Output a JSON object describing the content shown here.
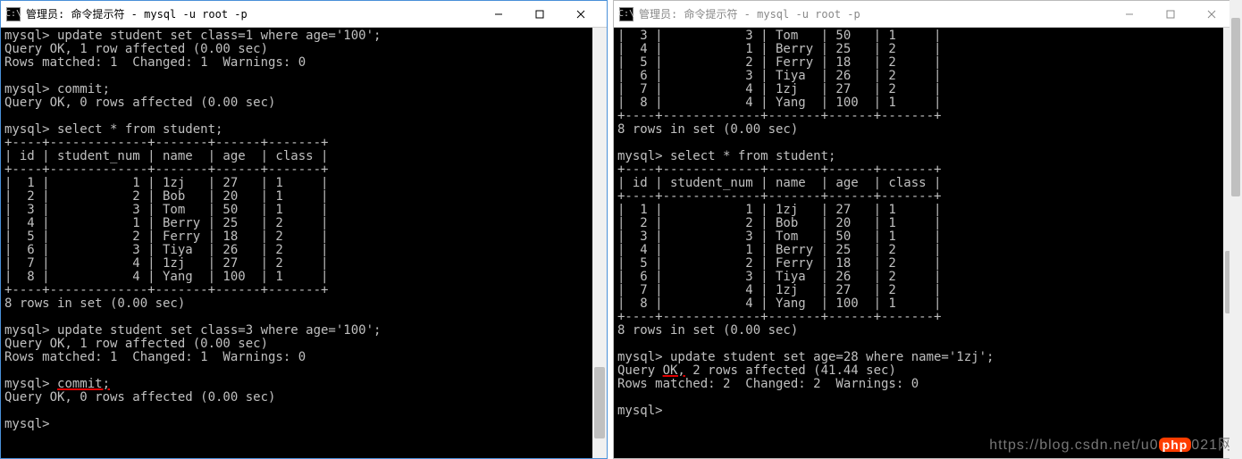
{
  "left": {
    "title": "管理员: 命令提示符 - mysql  -u root -p",
    "lines": [
      {
        "t": "mysql> update student set class=1 where age='100';"
      },
      {
        "t": "Query OK, 1 row affected (0.00 sec)"
      },
      {
        "t": "Rows matched: 1  Changed: 1  Warnings: 0"
      },
      {
        "t": ""
      },
      {
        "t": "mysql> commit;"
      },
      {
        "t": "Query OK, 0 rows affected (0.00 sec)"
      },
      {
        "t": ""
      },
      {
        "t": "mysql> select * from student;"
      },
      {
        "t": "+----+-------------+-------+------+-------+"
      },
      {
        "t": "| id | student_num | name  | age  | class |"
      },
      {
        "t": "+----+-------------+-------+------+-------+"
      },
      {
        "t": "|  1 |           1 | 1zj   | 27   | 1     |"
      },
      {
        "t": "|  2 |           2 | Bob   | 20   | 1     |"
      },
      {
        "t": "|  3 |           3 | Tom   | 50   | 1     |"
      },
      {
        "t": "|  4 |           1 | Berry | 25   | 2     |"
      },
      {
        "t": "|  5 |           2 | Ferry | 18   | 2     |"
      },
      {
        "t": "|  6 |           3 | Tiya  | 26   | 2     |"
      },
      {
        "t": "|  7 |           4 | 1zj   | 27   | 2     |"
      },
      {
        "t": "|  8 |           4 | Yang  | 100  | 1     |"
      },
      {
        "t": "+----+-------------+-------+------+-------+"
      },
      {
        "t": "8 rows in set (0.00 sec)"
      },
      {
        "t": ""
      },
      {
        "t": "mysql> update student set class=3 where age='100';"
      },
      {
        "t": "Query OK, 1 row affected (0.00 sec)"
      },
      {
        "t": "Rows matched: 1  Changed: 1  Warnings: 0"
      },
      {
        "t": ""
      },
      {
        "pre": "mysql> ",
        "u": "commit;",
        "post": ""
      },
      {
        "t": "Query OK, 0 rows affected (0.00 sec)"
      },
      {
        "t": ""
      },
      {
        "t": "mysql>"
      }
    ]
  },
  "right": {
    "title": "管理员: 命令提示符 - mysql  -u root -p",
    "lines": [
      {
        "t": "|  3 |           3 | Tom   | 50   | 1     |"
      },
      {
        "t": "|  4 |           1 | Berry | 25   | 2     |"
      },
      {
        "t": "|  5 |           2 | Ferry | 18   | 2     |"
      },
      {
        "t": "|  6 |           3 | Tiya  | 26   | 2     |"
      },
      {
        "t": "|  7 |           4 | 1zj   | 27   | 2     |"
      },
      {
        "t": "|  8 |           4 | Yang  | 100  | 1     |"
      },
      {
        "t": "+----+-------------+-------+------+-------+"
      },
      {
        "t": "8 rows in set (0.00 sec)"
      },
      {
        "t": ""
      },
      {
        "t": "mysql> select * from student;"
      },
      {
        "t": "+----+-------------+-------+------+-------+"
      },
      {
        "t": "| id | student_num | name  | age  | class |"
      },
      {
        "t": "+----+-------------+-------+------+-------+"
      },
      {
        "t": "|  1 |           1 | 1zj   | 27   | 1     |"
      },
      {
        "t": "|  2 |           2 | Bob   | 20   | 1     |"
      },
      {
        "t": "|  3 |           3 | Tom   | 50   | 1     |"
      },
      {
        "t": "|  4 |           1 | Berry | 25   | 2     |"
      },
      {
        "t": "|  5 |           2 | Ferry | 18   | 2     |"
      },
      {
        "t": "|  6 |           3 | Tiya  | 26   | 2     |"
      },
      {
        "t": "|  7 |           4 | 1zj   | 27   | 2     |"
      },
      {
        "t": "|  8 |           4 | Yang  | 100  | 1     |"
      },
      {
        "t": "+----+-------------+-------+------+-------+"
      },
      {
        "t": "8 rows in set (0.00 sec)"
      },
      {
        "t": ""
      },
      {
        "t": "mysql> update student set age=28 where name='1zj';"
      },
      {
        "pre": "Query ",
        "u": "OK,",
        "post": " 2 rows affected (41.44 sec)"
      },
      {
        "t": "Rows matched: 2  Changed: 2  Warnings: 0"
      },
      {
        "t": ""
      },
      {
        "t": "mysql>"
      }
    ]
  },
  "watermark": {
    "pre": "https://blog.csdn.net/u0",
    "badge": "php",
    "post": "021网"
  },
  "chart_data": {
    "type": "table",
    "title": "student",
    "columns": [
      "id",
      "student_num",
      "name",
      "age",
      "class"
    ],
    "left_select_rows": [
      [
        1,
        1,
        "1zj",
        27,
        1
      ],
      [
        2,
        2,
        "Bob",
        20,
        1
      ],
      [
        3,
        3,
        "Tom",
        50,
        1
      ],
      [
        4,
        1,
        "Berry",
        25,
        2
      ],
      [
        5,
        2,
        "Ferry",
        18,
        2
      ],
      [
        6,
        3,
        "Tiya",
        26,
        2
      ],
      [
        7,
        4,
        "1zj",
        27,
        2
      ],
      [
        8,
        4,
        "Yang",
        100,
        1
      ]
    ],
    "right_select_rows": [
      [
        1,
        1,
        "1zj",
        27,
        1
      ],
      [
        2,
        2,
        "Bob",
        20,
        1
      ],
      [
        3,
        3,
        "Tom",
        50,
        1
      ],
      [
        4,
        1,
        "Berry",
        25,
        2
      ],
      [
        5,
        2,
        "Ferry",
        18,
        2
      ],
      [
        6,
        3,
        "Tiya",
        26,
        2
      ],
      [
        7,
        4,
        "1zj",
        27,
        2
      ],
      [
        8,
        4,
        "Yang",
        100,
        1
      ]
    ]
  }
}
